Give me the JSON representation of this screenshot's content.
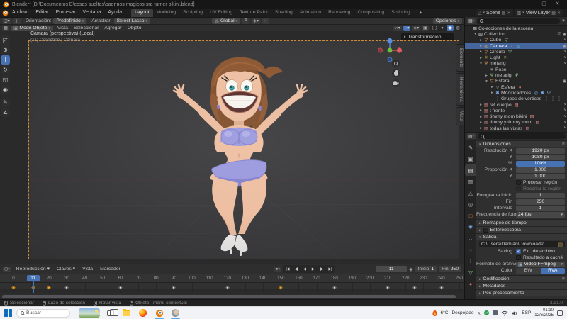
{
  "colors": {
    "accent_blue": "#4772b3",
    "camera_border": "#cf8a36",
    "key_orange": "#eda63a",
    "selected_row": "#44669c"
  },
  "titlebar": {
    "title": "Blender*  [D:\\Documentos B\\cosas sueltas\\padrinos magicos sra turner bikini.blend]",
    "minimize": "—",
    "maximize": "▢",
    "close": "✕"
  },
  "topbar": {
    "menus": [
      "Archivo",
      "Editar",
      "Procesar",
      "Ventana",
      "Ayuda"
    ],
    "workspaces": [
      "Layout",
      "Modeling",
      "Sculpting",
      "UV Editing",
      "Texture Paint",
      "Shading",
      "Animation",
      "Rendering",
      "Compositing",
      "Scripting"
    ],
    "active_workspace": "Layout",
    "add_workspace": "+",
    "scene": "Scene",
    "view_layer": "View Layer"
  },
  "tool_settings": {
    "orientation_label": "Orientación:",
    "orientation_value": "Predefinido",
    "drag_label": "Arrastrar:",
    "drag_value": "Select Lasso",
    "transform_space": "Global",
    "options_label": "Opciones"
  },
  "viewport": {
    "menus": [
      "Vista",
      "Seleccionar",
      "Agregar",
      "Objeto"
    ],
    "mode": "Modo Objeto",
    "overlay_line1": "Cámara (perspectiva) (Local)",
    "overlay_line2": "(11) Collection | Cámara",
    "n_panel": "Transformación",
    "side_tabs": [
      "Elemento",
      "Herramienta",
      "Vista"
    ],
    "tools": [
      "select-box",
      "cursor",
      "move",
      "rotate",
      "scale",
      "transform",
      "annotate",
      "measure"
    ],
    "active_tool": "move",
    "shading_modes": [
      "wireframe",
      "solid",
      "material-preview",
      "rendered"
    ],
    "active_shading": "material-preview"
  },
  "outliner": {
    "rows": [
      {
        "i": 0,
        "a": "none",
        "icon": "scene-collection",
        "label": "Colecciones de la escena"
      },
      {
        "i": 1,
        "a": "open",
        "icon": "collection",
        "label": "Collection",
        "right": "check-eye"
      },
      {
        "i": 2,
        "a": "closed",
        "icon": "mesh",
        "label": "Cubo",
        "tail": [
          "mesh-data"
        ],
        "right": "closed"
      },
      {
        "i": 2,
        "a": "closed",
        "icon": "camera",
        "label": "Cámara",
        "sel": true,
        "tail": [
          "constraint",
          "camera-data"
        ],
        "right": "open"
      },
      {
        "i": 2,
        "a": "closed",
        "icon": "mesh",
        "label": "Círculo",
        "tail": [
          "mesh-data"
        ],
        "right": "closed"
      },
      {
        "i": 2,
        "a": "closed",
        "icon": "light",
        "label": "Light",
        "tail": [
          "light-data"
        ],
        "right": "closed"
      },
      {
        "i": 2,
        "a": "open",
        "icon": "armature",
        "label": "metarig",
        "right": "closed"
      },
      {
        "i": 3,
        "a": "none",
        "icon": "pose",
        "label": "Pose"
      },
      {
        "i": 3,
        "a": "closed",
        "icon": "armature-green",
        "label": "metarig",
        "tail": [
          "armature-green"
        ]
      },
      {
        "i": 3,
        "a": "open",
        "icon": "mesh",
        "label": "Esfera",
        "right": "open"
      },
      {
        "i": 4,
        "a": "closed",
        "icon": "mesh-data",
        "label": "Esfera",
        "tail": [
          "material"
        ]
      },
      {
        "i": 4,
        "a": "closed",
        "icon": "modifiers",
        "label": "Modificadores",
        "tail": [
          "mod-a",
          "mod-b",
          "mod-c"
        ]
      },
      {
        "i": 4,
        "a": "none",
        "icon": "vgroups",
        "label": "Grupos de vértices",
        "tail": [
          "vg",
          "vg",
          "vg"
        ]
      },
      {
        "i": 2,
        "a": "closed",
        "icon": "image",
        "label": "ref cuerpo",
        "tail": [
          "image-small"
        ],
        "right": "closed"
      },
      {
        "i": 2,
        "a": "closed",
        "icon": "image",
        "label": "t frente",
        "right": "closed"
      },
      {
        "i": 2,
        "a": "closed",
        "icon": "image",
        "label": "timmy mom bikini",
        "tail": [
          "image-small"
        ],
        "right": "closed"
      },
      {
        "i": 2,
        "a": "closed",
        "icon": "image",
        "label": "timmy y timmy mom",
        "tail": [
          "image-small"
        ],
        "right": "closed"
      },
      {
        "i": 2,
        "a": "closed",
        "icon": "image",
        "label": "todas las vistas",
        "tail": [
          "image-small"
        ],
        "right": "closed"
      }
    ]
  },
  "properties": {
    "tabs": [
      "tool",
      "render",
      "output",
      "view-layer",
      "scene",
      "world",
      "object",
      "modifiers",
      "particles",
      "physics",
      "constraints",
      "object-data",
      "material"
    ],
    "active_tab": "output",
    "panels": [
      {
        "type": "open",
        "title": "Dimensiones",
        "menu": true,
        "rows": [
          {
            "t": "field",
            "label": "Resolución X",
            "value": "1920 px"
          },
          {
            "t": "field",
            "label": "Y",
            "value": "1080 px"
          },
          {
            "t": "slider",
            "label": "%",
            "value": "100%"
          },
          {
            "t": "field",
            "label": "Proporción X",
            "value": "1.000"
          },
          {
            "t": "field",
            "label": "Y",
            "value": "1.000"
          },
          {
            "t": "check",
            "label": "",
            "text": "Procesar región",
            "checked": false
          },
          {
            "t": "check",
            "label": "",
            "text": "Recortar la región",
            "checked": false,
            "dim": true
          },
          {
            "t": "field",
            "label": "Fotograma  Inicio",
            "value": "1"
          },
          {
            "t": "field",
            "label": "Fin",
            "value": "250"
          },
          {
            "t": "field",
            "label": "Intervalo",
            "value": "1"
          },
          {
            "t": "drop",
            "label": "Frecuencia de fotog...",
            "value": "24 fps"
          }
        ]
      },
      {
        "type": "closed",
        "title": "Remapeo de tiempo"
      },
      {
        "type": "closed",
        "title": "Estereoscopía",
        "checkbox": true
      },
      {
        "type": "open",
        "title": "Salida",
        "rows": [
          {
            "t": "path",
            "value": "C:\\Users\\Damian\\Downloads\\"
          },
          {
            "t": "check",
            "label": "Saving",
            "text": "Ext. de archivo",
            "checked": true
          },
          {
            "t": "check",
            "label": "",
            "text": "Resultado a caché",
            "checked": false
          },
          {
            "t": "drop",
            "label": "Formato de archivo",
            "value": "Video FFmpeg",
            "icon": true
          },
          {
            "t": "seg",
            "label": "Color",
            "options": [
              "BW",
              "RVA"
            ],
            "active": 1
          }
        ]
      },
      {
        "type": "closed",
        "title": "Codificación",
        "menu": true
      },
      {
        "type": "closed",
        "title": "Metadatos"
      },
      {
        "type": "closed",
        "title": "Pos procesamiento"
      }
    ]
  },
  "timeline": {
    "menus": [
      "Reproducción",
      "Claves",
      "Vista",
      "Marcador"
    ],
    "transport": [
      "jump-start",
      "prev-keyframe",
      "play-reverse",
      "play",
      "next-keyframe",
      "jump-end"
    ],
    "current_frame": "11",
    "start_label": "Inicio",
    "start_value": "1",
    "end_label": "Fin",
    "end_value": "250",
    "ruler": {
      "min": 0,
      "max": 250,
      "step": 10,
      "hidden": [
        10
      ],
      "current": 11
    },
    "keys_orange": [
      0,
      11,
      20,
      150
    ],
    "keys_white": [
      30,
      60,
      90,
      120,
      180,
      210,
      225,
      240
    ]
  },
  "statusbar": {
    "items": [
      {
        "button": "lmb",
        "label": "Seleccionar"
      },
      {
        "button": "lmb",
        "label": "Lazo de selección"
      },
      {
        "button": "mmb",
        "label": "Rotar vista"
      },
      {
        "button": "rmb",
        "label": "Objeto - menú contextual"
      }
    ],
    "version": "2.91.0"
  },
  "taskbar": {
    "search": "Buscar",
    "apps": [
      "task-view",
      "explorer",
      "firefox",
      "blender",
      "image-editor"
    ],
    "running": [
      "blender",
      "image-editor"
    ],
    "weather_temp": "6°C",
    "weather_cond": "Despejado",
    "language": "ESP",
    "time": "01:10",
    "date": "12/6/2025"
  }
}
